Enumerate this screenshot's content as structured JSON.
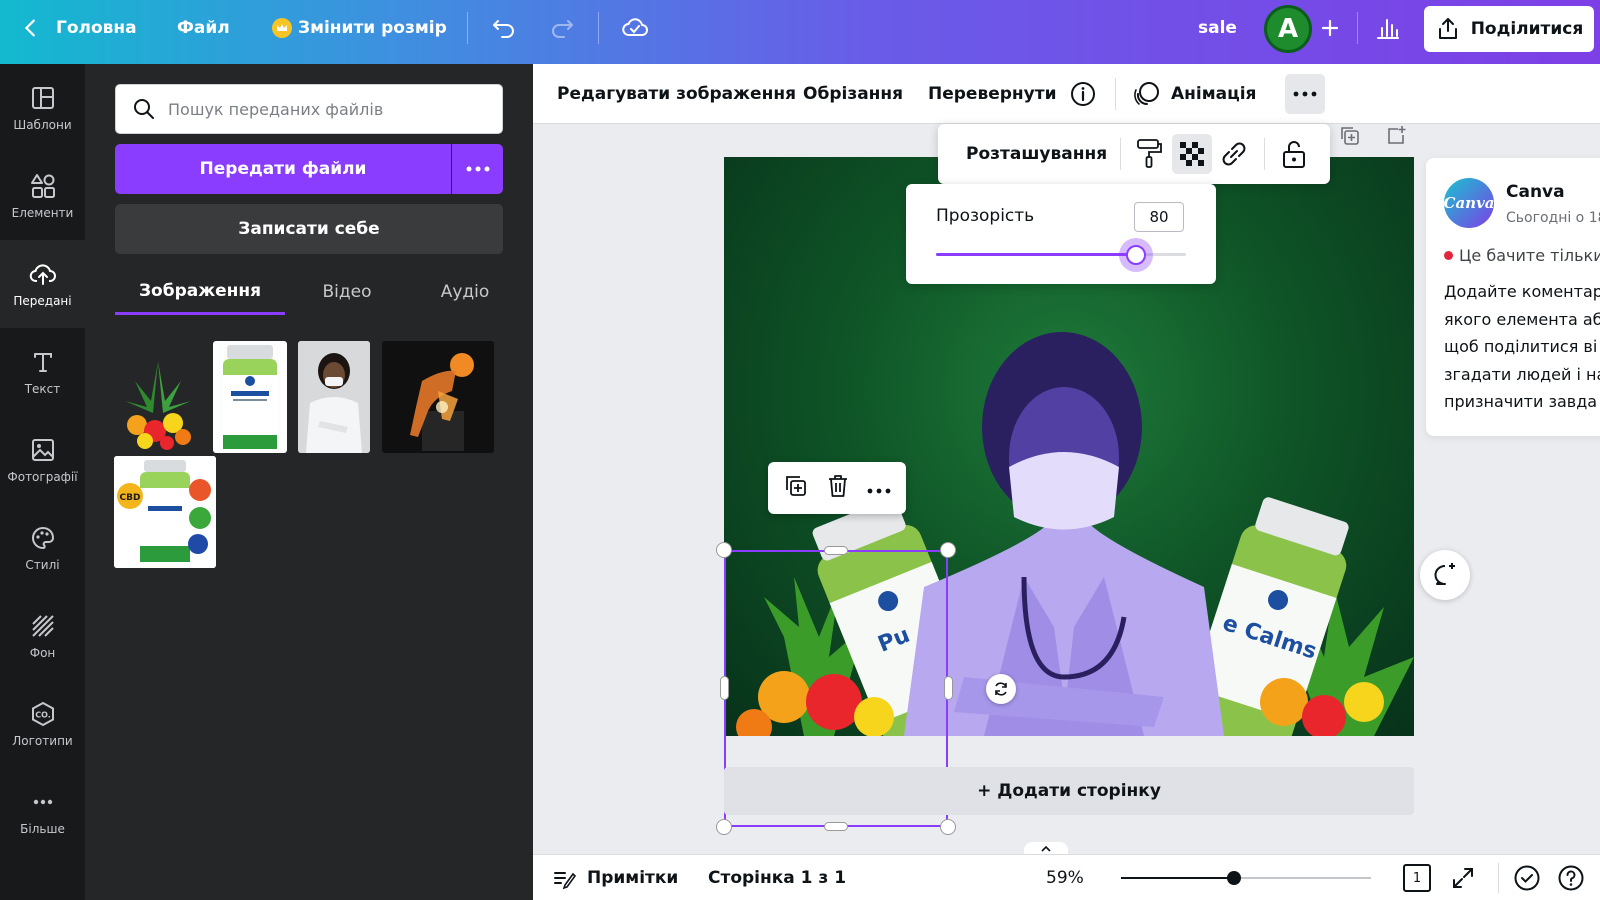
{
  "topbar": {
    "home_label": "Головна",
    "file_label": "Файл",
    "resize_label": "Змінити розмір",
    "doc_name": "sale",
    "avatar_letter": "A",
    "share_label": "Поділитися"
  },
  "rail": {
    "items": [
      {
        "label": "Шаблони",
        "icon": "templates-icon"
      },
      {
        "label": "Елементи",
        "icon": "elements-icon"
      },
      {
        "label": "Передані",
        "icon": "uploads-icon"
      },
      {
        "label": "Текст",
        "icon": "text-icon"
      },
      {
        "label": "Фотографії",
        "icon": "photos-icon"
      },
      {
        "label": "Стилі",
        "icon": "styles-icon"
      },
      {
        "label": "Фон",
        "icon": "background-icon"
      },
      {
        "label": "Логотипи",
        "icon": "logos-icon"
      },
      {
        "label": "Більше",
        "icon": "more-icon"
      }
    ],
    "active_index": 2
  },
  "panel": {
    "search_placeholder": "Пошук переданих файлів",
    "upload_label": "Передати файли",
    "record_label": "Записати себе",
    "tabs": [
      {
        "label": "Зображення",
        "active": true
      },
      {
        "label": "Відео",
        "active": false
      },
      {
        "label": "Аудіо",
        "active": false
      }
    ]
  },
  "context_toolbar": {
    "edit_image": "Редагувати зображення",
    "crop": "Обрізання",
    "flip": "Перевернути",
    "animation": "Анімація"
  },
  "arrange_popup": {
    "position_label": "Розташування"
  },
  "transparency": {
    "label": "Прозорість",
    "value": "80",
    "fraction": 0.8
  },
  "canvas": {
    "add_page_label": "+ Додати сторінку",
    "product_text_left": "Pu",
    "product_text_right": "e Calms"
  },
  "comment_panel": {
    "author": "Canva",
    "time": "Сьогодні о 18",
    "notice": "Це бачите тільки",
    "body_lines": [
      "Додайте коментар",
      "якого елемента аб",
      "щоб поділитися ві",
      "згадати людей і на",
      "призначити завда"
    ]
  },
  "bottombar": {
    "notes_label": "Примітки",
    "page_label": "Сторінка 1 з 1",
    "zoom": "59%",
    "zoom_fraction": 0.45,
    "page_count": "1"
  },
  "colors": {
    "accent": "#8b3dff",
    "rail_bg": "#18191b",
    "panel_bg": "#252627"
  }
}
